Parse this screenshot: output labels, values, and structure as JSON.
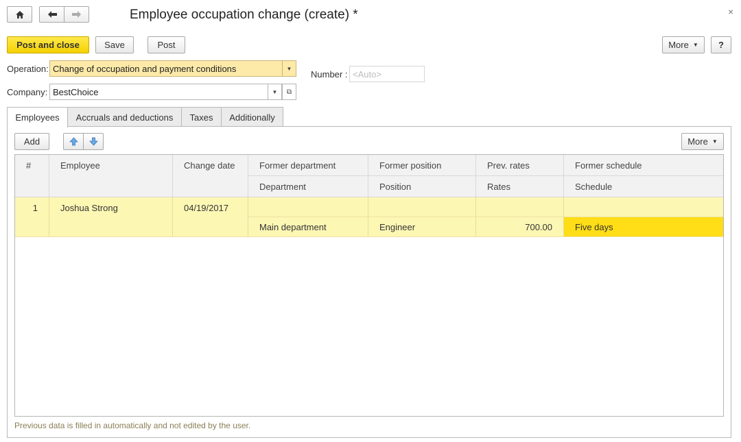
{
  "window": {
    "title": "Employee occupation change (create) *",
    "close_symbol": "×"
  },
  "nav": {
    "home_icon": "home-icon",
    "back_icon": "arrow-left-icon",
    "forward_icon": "arrow-right-icon"
  },
  "toolbar": {
    "post_and_close": "Post and close",
    "save": "Save",
    "post": "Post",
    "more": "More",
    "help": "?"
  },
  "form": {
    "operation_label": "Operation:",
    "operation_value": "Change of occupation and payment conditions",
    "company_label": "Company:",
    "company_value": "BestChoice",
    "number_label": "Number :",
    "number_placeholder": "<Auto>"
  },
  "tabs": [
    {
      "label": "Employees",
      "active": true
    },
    {
      "label": "Accruals and deductions",
      "active": false
    },
    {
      "label": "Taxes",
      "active": false
    },
    {
      "label": "Additionally",
      "active": false
    }
  ],
  "table_toolbar": {
    "add": "Add",
    "move_up_icon": "move-up-icon",
    "move_down_icon": "move-down-icon",
    "more": "More"
  },
  "table": {
    "headers_top": [
      "#",
      "Employee",
      "Change date",
      "Former department",
      "Former position",
      "Prev. rates",
      "Former schedule"
    ],
    "headers_bottom": [
      "Department",
      "Position",
      "Rates",
      "Schedule"
    ],
    "rows": [
      {
        "number": "1",
        "employee": "Joshua Strong",
        "change_date": "04/19/2017",
        "former_department": "",
        "former_position": "",
        "prev_rates": "",
        "former_schedule": "",
        "department": "Main department",
        "position": "Engineer",
        "rates": "700.00",
        "schedule": "Five days"
      }
    ]
  },
  "footnote": "Previous data is filled in automatically and not edited by the user.",
  "colors": {
    "accent_yellow": "#f5d000",
    "row_highlight": "#fdf7b4",
    "selected_cell": "#ffdd17",
    "field_highlight": "#fdeaa8"
  }
}
